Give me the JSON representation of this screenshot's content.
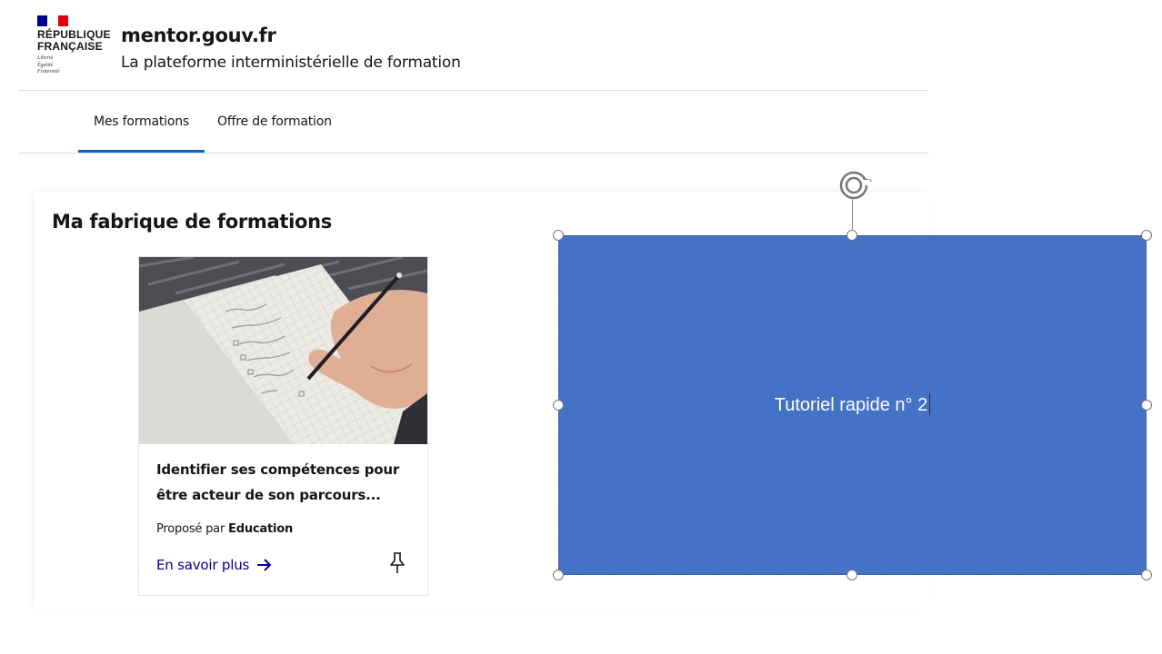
{
  "header": {
    "logo_lines": [
      "RÉPUBLIQUE",
      "FRANÇAISE"
    ],
    "devise": [
      "Liberté",
      "Égalité",
      "Fraternité"
    ],
    "service_title": "mentor.gouv.fr",
    "service_tagline": "La plateforme interministérielle de formation"
  },
  "nav": {
    "tabs": [
      {
        "label": "Mes formations",
        "active": true
      },
      {
        "label": "Offre de formation",
        "active": false
      }
    ]
  },
  "main": {
    "title": "Ma fabrique de formations",
    "card": {
      "title": "Identifier ses compétences pour être acteur de son parcours...",
      "provider_prefix": "Proposé par",
      "provider_name": "Education",
      "link_label": "En savoir plus",
      "arrow_icon": "arrow-right-icon",
      "pin_icon": "pin-icon"
    }
  },
  "slide_shape": {
    "text": "Tutoriel rapide n° 2",
    "fill_color": "#4472c4",
    "text_color": "#ffffff"
  },
  "colors": {
    "brand_blue": "#000091",
    "active_tab_underline": "#0a63c9",
    "flag_blue": "#000091",
    "flag_red": "#e1000f"
  }
}
